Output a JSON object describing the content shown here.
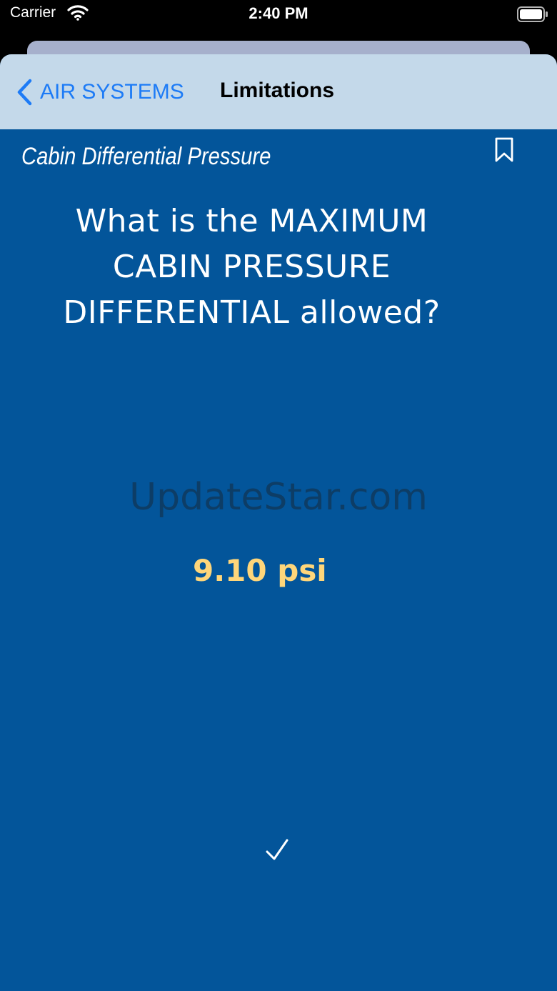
{
  "status_bar": {
    "carrier": "Carrier",
    "time": "2:40 PM"
  },
  "nav": {
    "back_label": "AIR SYSTEMS",
    "title": "Limitations"
  },
  "card": {
    "category": "Cabin Differential Pressure",
    "question": "What is the MAXIMUM CABIN PRESSURE DIFFERENTIAL allowed?",
    "answer": "9.10 psi"
  },
  "watermark": "UpdateStar.com",
  "colors": {
    "card_background": "#03559a",
    "nav_background": "#c4d9ea",
    "accent": "#1d7bf6",
    "answer": "#ffd67a"
  },
  "icons": {
    "back": "chevron-left-icon",
    "bookmark": "bookmark-icon",
    "check": "checkmark-icon",
    "wifi": "wifi-icon",
    "battery": "battery-icon"
  }
}
